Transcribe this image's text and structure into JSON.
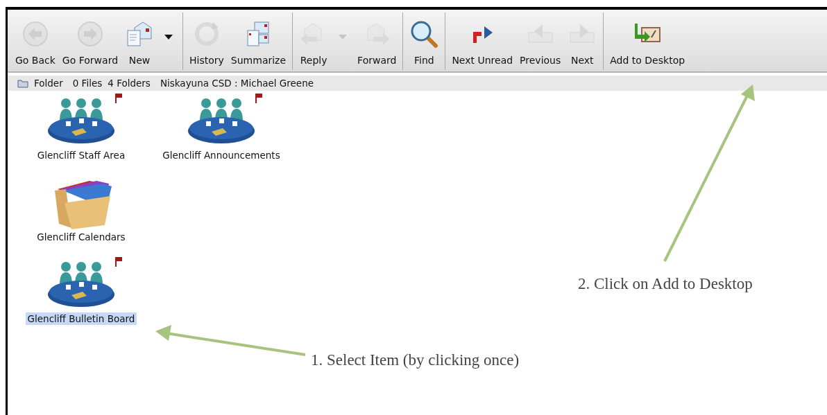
{
  "toolbar": {
    "groups": [
      {
        "buttons": [
          {
            "kind": "back",
            "label": "Go Back",
            "disabled": true
          },
          {
            "kind": "forward-nav",
            "label": "Go Forward",
            "disabled": true
          },
          {
            "kind": "new",
            "label": "New",
            "disabled": false
          },
          {
            "kind": "dropdown",
            "disabled": false
          }
        ]
      },
      {
        "buttons": [
          {
            "kind": "history",
            "label": "History",
            "disabled": true
          },
          {
            "kind": "summarize",
            "label": "Summarize",
            "disabled": false
          }
        ]
      },
      {
        "buttons": [
          {
            "kind": "reply",
            "label": "Reply",
            "disabled": true
          },
          {
            "kind": "dropdown",
            "disabled": true
          },
          {
            "kind": "forward",
            "label": "Forward",
            "disabled": true
          }
        ]
      },
      {
        "buttons": [
          {
            "kind": "find",
            "label": "Find",
            "disabled": false
          }
        ]
      },
      {
        "buttons": [
          {
            "kind": "next-unread",
            "label": "Next Unread",
            "disabled": false
          },
          {
            "kind": "previous",
            "label": "Previous",
            "disabled": true
          },
          {
            "kind": "next",
            "label": "Next",
            "disabled": true
          }
        ]
      },
      {
        "buttons": [
          {
            "kind": "add-desktop",
            "label": "Add to Desktop",
            "disabled": false
          }
        ]
      }
    ]
  },
  "status_bar": {
    "type": "Folder",
    "files": "0 Files",
    "folders": "4 Folders",
    "path": "Niskayuna CSD : Michael Greene"
  },
  "items": [
    {
      "kind": "conference",
      "label": "Glencliff Staff Area",
      "flagged": true,
      "selected": false
    },
    {
      "kind": "conference",
      "label": "Glencliff Announcements",
      "flagged": true,
      "selected": false
    },
    {
      "kind": "folder",
      "label": "Glencliff Calendars",
      "flagged": false,
      "selected": false
    },
    {
      "kind": "conference",
      "label": "Glencliff Bulletin Board",
      "flagged": true,
      "selected": true
    }
  ],
  "annotations": [
    {
      "text": "1.  Select Item (by clicking once)"
    },
    {
      "text": "2. Click on Add to Desktop"
    }
  ]
}
